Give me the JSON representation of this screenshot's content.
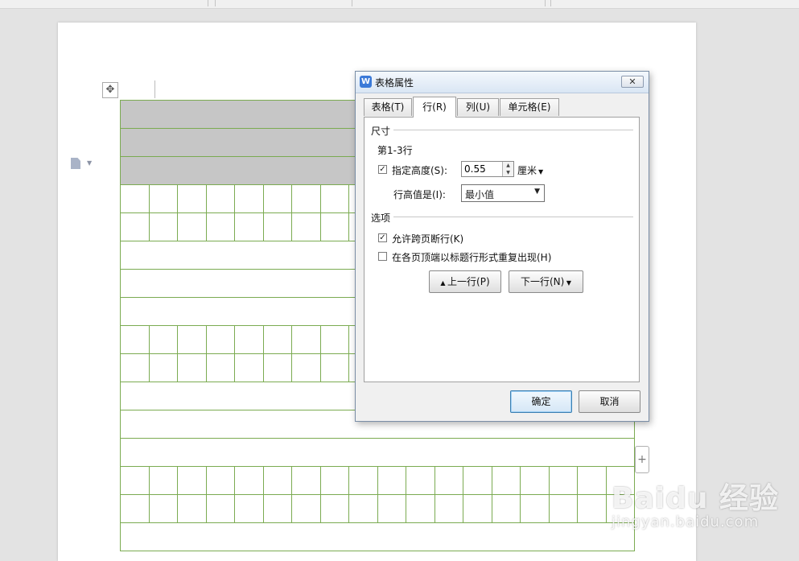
{
  "dialog": {
    "title": "表格属性",
    "app_icon": "W",
    "close_label": "✕",
    "tabs": [
      "表格(T)",
      "行(R)",
      "列(U)",
      "单元格(E)"
    ],
    "active_tab": "行(R)",
    "size_group": {
      "label": "尺寸",
      "rows_label": "第1-3行",
      "specify_height_label": "指定高度(S):",
      "specify_height_checked": true,
      "height_value": "0.55",
      "unit": "厘米",
      "row_height_is_label": "行高值是(I):",
      "row_height_mode": "最小值"
    },
    "options_group": {
      "label": "选项",
      "allow_break_label": "允许跨页断行(K)",
      "allow_break_checked": true,
      "repeat_header_label": "在各页顶端以标题行形式重复出现(H)",
      "repeat_header_checked": false
    },
    "prev_row_label": "上一行(P)",
    "next_row_label": "下一行(N)",
    "ok_label": "确定",
    "cancel_label": "取消"
  },
  "document": {
    "table_pattern": [
      "shaded",
      "shaded",
      "shaded",
      "grid",
      "grid",
      "merged",
      "merged",
      "merged",
      "grid",
      "grid",
      "merged",
      "merged",
      "merged",
      "grid",
      "grid",
      "merged"
    ],
    "grid_columns": 18,
    "add_row_label": "+",
    "move_handle_label": "✥"
  },
  "watermark": {
    "main": "Baidu 经验",
    "sub": "jingyan.baidu.com"
  },
  "colors": {
    "table_border": "#7bab51",
    "shaded_fill": "#c6c6c6",
    "dialog_bg": "#f0f0f0",
    "default_button_border": "#3c7fb1"
  }
}
